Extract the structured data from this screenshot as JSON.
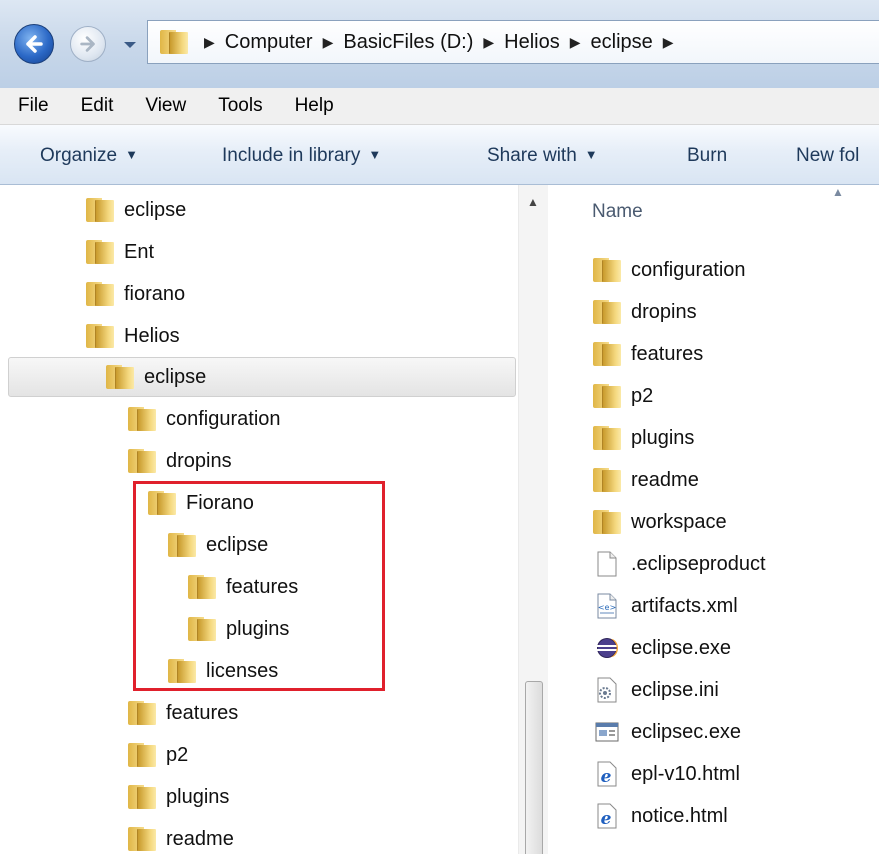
{
  "address_bar": {
    "breadcrumbs": [
      "Computer",
      "BasicFiles (D:)",
      "Helios",
      "eclipse"
    ]
  },
  "menu": [
    "File",
    "Edit",
    "View",
    "Tools",
    "Help"
  ],
  "command_bar": {
    "organize": "Organize",
    "include_in_library": "Include in library",
    "share_with": "Share with",
    "burn": "Burn",
    "new_folder": "New fol"
  },
  "nav_tree": [
    {
      "label": "eclipse",
      "indent": 0
    },
    {
      "label": "Ent",
      "indent": 0
    },
    {
      "label": "fiorano",
      "indent": 0
    },
    {
      "label": "Helios",
      "indent": 0
    },
    {
      "label": "eclipse",
      "indent": 1,
      "selected": true
    },
    {
      "label": "configuration",
      "indent": 2
    },
    {
      "label": "dropins",
      "indent": 2
    },
    {
      "label": "Fiorano",
      "indent": 3
    },
    {
      "label": "eclipse",
      "indent": 4
    },
    {
      "label": "features",
      "indent": 5
    },
    {
      "label": "plugins",
      "indent": 5
    },
    {
      "label": "licenses",
      "indent": 4
    },
    {
      "label": "features",
      "indent": 2
    },
    {
      "label": "p2",
      "indent": 2
    },
    {
      "label": "plugins",
      "indent": 2
    },
    {
      "label": "readme",
      "indent": 2
    }
  ],
  "file_list": {
    "column_header": "Name",
    "items": [
      {
        "name": "configuration",
        "icon": "folder-icon"
      },
      {
        "name": "dropins",
        "icon": "folder-icon"
      },
      {
        "name": "features",
        "icon": "folder-icon"
      },
      {
        "name": "p2",
        "icon": "folder-icon"
      },
      {
        "name": "plugins",
        "icon": "folder-icon"
      },
      {
        "name": "readme",
        "icon": "folder-icon"
      },
      {
        "name": "workspace",
        "icon": "folder-icon"
      },
      {
        "name": ".eclipseproduct",
        "icon": "blank-file-icon"
      },
      {
        "name": "artifacts.xml",
        "icon": "xml-file-icon"
      },
      {
        "name": "eclipse.exe",
        "icon": "eclipse-app-icon"
      },
      {
        "name": "eclipse.ini",
        "icon": "config-file-icon"
      },
      {
        "name": "eclipsec.exe",
        "icon": "console-app-icon"
      },
      {
        "name": "epl-v10.html",
        "icon": "ie-html-icon"
      },
      {
        "name": "notice.html",
        "icon": "ie-html-icon"
      }
    ]
  },
  "colors": {
    "highlight_box": "#e0202c",
    "command_text": "#1e395b"
  }
}
